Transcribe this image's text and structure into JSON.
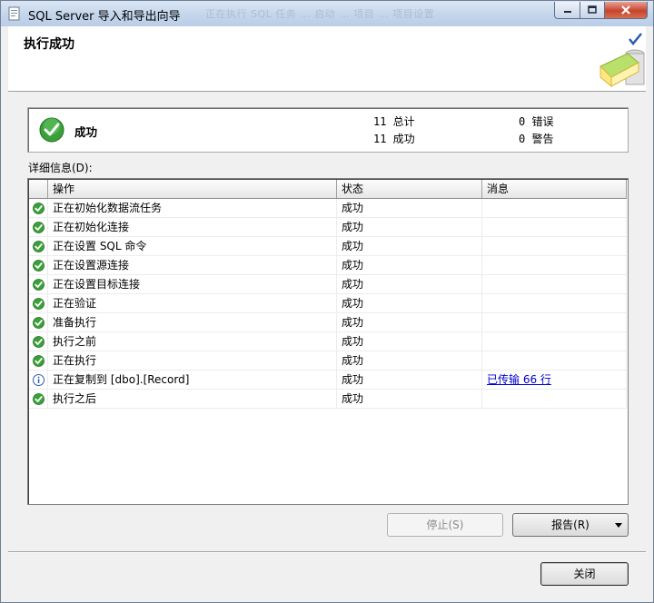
{
  "window": {
    "title": "SQL Server 导入和导出向导",
    "background_bleed": "正在执行 SQL 任务 ... 启动 ... 项目 ... 项目设置"
  },
  "header": {
    "title": "执行成功"
  },
  "summary": {
    "status": "成功",
    "total": "11 总计",
    "success": "11 成功",
    "errors": "0 错误",
    "warnings": "0 警告"
  },
  "details_label": "详细信息(D):",
  "grid": {
    "columns": [
      "操作",
      "状态",
      "消息"
    ],
    "rows": [
      {
        "icon": "success-check-icon",
        "action": "正在初始化数据流任务",
        "status": "成功",
        "message": ""
      },
      {
        "icon": "success-check-icon",
        "action": "正在初始化连接",
        "status": "成功",
        "message": ""
      },
      {
        "icon": "success-check-icon",
        "action": "正在设置 SQL 命令",
        "status": "成功",
        "message": ""
      },
      {
        "icon": "success-check-icon",
        "action": "正在设置源连接",
        "status": "成功",
        "message": ""
      },
      {
        "icon": "success-check-icon",
        "action": "正在设置目标连接",
        "status": "成功",
        "message": ""
      },
      {
        "icon": "success-check-icon",
        "action": "正在验证",
        "status": "成功",
        "message": ""
      },
      {
        "icon": "success-check-icon",
        "action": "准备执行",
        "status": "成功",
        "message": ""
      },
      {
        "icon": "success-check-icon",
        "action": "执行之前",
        "status": "成功",
        "message": ""
      },
      {
        "icon": "success-check-icon",
        "action": "正在执行",
        "status": "成功",
        "message": ""
      },
      {
        "icon": "info-icon",
        "action": "正在复制到 [dbo].[Record]",
        "status": "成功",
        "message": "已传输 66 行"
      },
      {
        "icon": "success-check-icon",
        "action": "执行之后",
        "status": "成功",
        "message": ""
      }
    ]
  },
  "buttons": {
    "stop": "停止(S)",
    "report": "报告(R)",
    "close": "关闭"
  },
  "colors": {
    "success_green": "#3aa13a",
    "info_blue": "#2a5db0",
    "link": "#0000cc"
  }
}
